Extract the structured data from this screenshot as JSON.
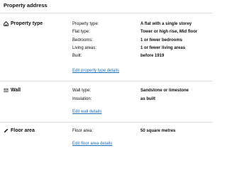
{
  "page_heading": "Property address",
  "sections": [
    {
      "title": "Property type",
      "icon": "house-icon",
      "rows": [
        {
          "label": "Property type:",
          "value": "A flat with a single storey"
        },
        {
          "label": "Flat type:",
          "value": "Tower or high rise, Mid floor"
        },
        {
          "label": "Bedrooms:",
          "value": "1 or fewer bedrooms"
        },
        {
          "label": "Living areas:",
          "value": "1 or fewer living areas"
        },
        {
          "label": "Built:",
          "value": "before 1919"
        }
      ],
      "edit_link": "Edit property type details"
    },
    {
      "title": "Wall",
      "icon": "wall-icon",
      "rows": [
        {
          "label": "Wall type:",
          "value": "Sandstone or limestone"
        },
        {
          "label": "Insulation:",
          "value": "as built"
        }
      ],
      "edit_link": "Edit wall details"
    },
    {
      "title": "Floor area",
      "icon": "pencil-icon",
      "rows": [
        {
          "label": "Floor area:",
          "value": "50 square metres"
        }
      ],
      "edit_link": "Edit floor area details"
    }
  ],
  "colors": {
    "link": "#1d70b8",
    "text": "#0b0c0c",
    "divider": "#dcdcdc"
  }
}
